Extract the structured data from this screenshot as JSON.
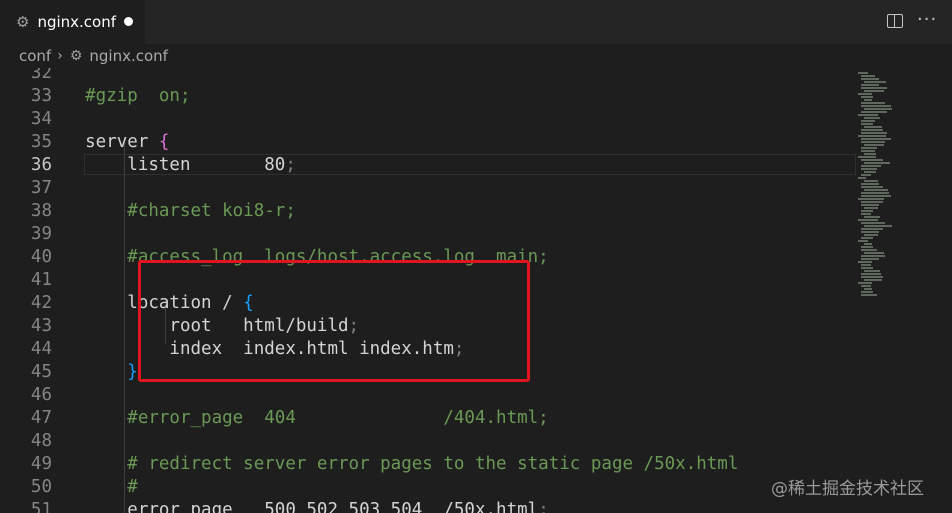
{
  "tab": {
    "title": "nginx.conf",
    "icon": "gear-icon",
    "modified": true
  },
  "toolbar": {
    "split_icon": "split-editor-icon",
    "more_label": "···"
  },
  "breadcrumb": {
    "folder": "conf",
    "separator": "›",
    "file": "nginx.conf"
  },
  "editor": {
    "current_line": "36",
    "lines": [
      {
        "n": "32",
        "tokens": []
      },
      {
        "n": "33",
        "tokens": [
          {
            "t": "    #gzip  on;",
            "c": "cm"
          }
        ]
      },
      {
        "n": "34",
        "tokens": []
      },
      {
        "n": "35",
        "tokens": [
          {
            "t": "    server ",
            "c": "kw"
          },
          {
            "t": "{",
            "c": "br1"
          }
        ]
      },
      {
        "n": "36",
        "tokens": [
          {
            "t": "        listen       80",
            "c": "kw"
          },
          {
            "t": ";",
            "c": "semi"
          }
        ]
      },
      {
        "n": "37",
        "tokens": []
      },
      {
        "n": "38",
        "tokens": [
          {
            "t": "        #charset koi8-r;",
            "c": "cm"
          }
        ]
      },
      {
        "n": "39",
        "tokens": []
      },
      {
        "n": "40",
        "tokens": [
          {
            "t": "        #access_log  logs/host.access.log  main;",
            "c": "cm"
          }
        ]
      },
      {
        "n": "41",
        "tokens": []
      },
      {
        "n": "42",
        "tokens": [
          {
            "t": "        location / ",
            "c": "kw"
          },
          {
            "t": "{",
            "c": "br2"
          }
        ]
      },
      {
        "n": "43",
        "tokens": [
          {
            "t": "            root   html/build",
            "c": "kw"
          },
          {
            "t": ";",
            "c": "semi"
          }
        ]
      },
      {
        "n": "44",
        "tokens": [
          {
            "t": "            index  index.html index.htm",
            "c": "kw"
          },
          {
            "t": ";",
            "c": "semi"
          }
        ]
      },
      {
        "n": "45",
        "tokens": [
          {
            "t": "        ",
            "c": "kw"
          },
          {
            "t": "}",
            "c": "br2"
          }
        ]
      },
      {
        "n": "46",
        "tokens": []
      },
      {
        "n": "47",
        "tokens": [
          {
            "t": "        #error_page  404              /404.html;",
            "c": "cm"
          }
        ]
      },
      {
        "n": "48",
        "tokens": []
      },
      {
        "n": "49",
        "tokens": [
          {
            "t": "        # redirect server error pages to the static page /50x.html",
            "c": "cm"
          }
        ]
      },
      {
        "n": "50",
        "tokens": [
          {
            "t": "        #",
            "c": "cm"
          }
        ]
      },
      {
        "n": "51",
        "tokens": [
          {
            "t": "        error_page   500 502 503 504  /50x.html",
            "c": "kw"
          },
          {
            "t": ";",
            "c": "semi"
          }
        ]
      }
    ]
  },
  "colors": {
    "highlight_box": "#e0151f",
    "comment": "#6a9955",
    "bracket_server": "#da70d6",
    "bracket_location": "#179fff"
  },
  "watermark": "@稀土掘金技术社区"
}
